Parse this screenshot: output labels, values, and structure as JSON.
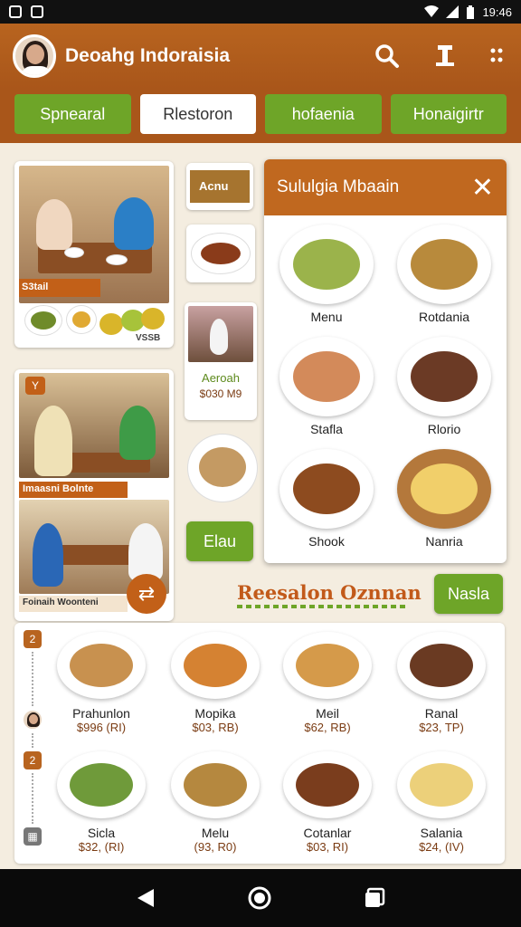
{
  "status": {
    "time": "19:46"
  },
  "header": {
    "title": "Deoahg Indoraisia"
  },
  "tabs": [
    {
      "label": "Spnearal",
      "active": false
    },
    {
      "label": "Rlestoron",
      "active": true
    },
    {
      "label": "hofaenia",
      "active": false
    },
    {
      "label": "Honaigirtr",
      "active": false
    }
  ],
  "gallery": {
    "photo1_caption": "S3tail",
    "photo1_badge": "VSSB",
    "photo2_badge": "Y",
    "photo2_caption": "Imaasni Bolnte",
    "photo3_caption": "Foinaih Woonteni",
    "thumb1_label": "Acnu",
    "thumb3_title": "Aeroah",
    "thumb3_price": "$030 M9",
    "thumb_button": "Elau"
  },
  "modal": {
    "title": "Sululgia Mbaain",
    "close": "✕",
    "items": [
      "Menu",
      "Rotdania",
      "Stafla",
      "Rlorio",
      "Shook",
      "Nanria"
    ]
  },
  "section": {
    "title": "Reesalon Oznnan",
    "button": "Nasla"
  },
  "list": {
    "badge1": "2",
    "badge2": "2",
    "row1": [
      {
        "name": "Prahunlon",
        "price": "$996 (RI)"
      },
      {
        "name": "Mopika",
        "price": "$03, RB)"
      },
      {
        "name": "Meil",
        "price": "$62, RB)"
      },
      {
        "name": "Ranal",
        "price": "$23, TP)"
      }
    ],
    "row2": [
      {
        "name": "Sicla",
        "price": "$32, (RI)"
      },
      {
        "name": "Melu",
        "price": "(93, R0)"
      },
      {
        "name": "Cotanlar",
        "price": "$03, RI)"
      },
      {
        "name": "Salania",
        "price": "$24, (IV)"
      }
    ]
  },
  "colors": {
    "brand": "#b8641f",
    "accent_green": "#6ea528",
    "title_orange": "#c25a1a"
  }
}
